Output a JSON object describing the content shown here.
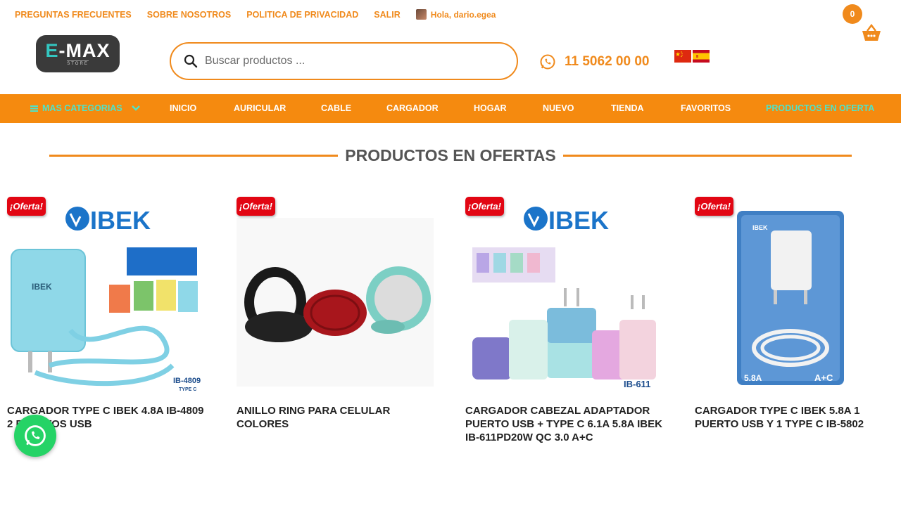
{
  "topbar": {
    "links": [
      "PREGUNTAS FRECUENTES",
      "SOBRE NOSOTROS",
      "POLITICA DE PRIVACIDAD",
      "SALIR"
    ],
    "greeting": "Hola, dario.egea"
  },
  "cart": {
    "count": "0",
    "icon": "basket-icon"
  },
  "logo": {
    "main_e": "E",
    "main_rest": "-MAX",
    "sub": "STORE"
  },
  "search": {
    "placeholder": "Buscar productos ...",
    "value": ""
  },
  "phone": {
    "number": "11 5062 00 00",
    "icon": "whatsapp-icon"
  },
  "flags": [
    "china-flag",
    "spain-flag"
  ],
  "nav": {
    "categories_label": "MAS CATEGORIAS",
    "items": [
      "INICIO",
      "AURICULAR",
      "CABLE",
      "CARGADOR",
      "HOGAR",
      "NUEVO",
      "TIENDA",
      "FAVORITOS",
      "PRODUCTOS EN OFERTA"
    ]
  },
  "section": {
    "title": "PRODUCTOS EN OFERTAS"
  },
  "products": [
    {
      "badge": "¡Oferta!",
      "name": "CARGADOR TYPE C IBEK 4.8A IB-4809 2 PUERTOS USB",
      "img_brand": "IBEK",
      "img_model": "IB-4809",
      "img_sub": "TYPE C"
    },
    {
      "badge": "¡Oferta!",
      "name": "ANILLO RING PARA CELULAR COLORES"
    },
    {
      "badge": "¡Oferta!",
      "name": "CARGADOR CABEZAL ADAPTADOR PUERTO USB + TYPE C 6.1A 5.8A IBEK IB-611PD20W QC 3.0 A+C",
      "img_brand": "IBEK",
      "img_model": "IB-611"
    },
    {
      "badge": "¡Oferta!",
      "name": "CARGADOR TYPE C IBEK 5.8A 1 PUERTO USB Y 1 TYPE C IB-5802",
      "img_brand": "IBEK",
      "img_model": "5.8A",
      "img_sub": "A+C"
    }
  ],
  "colors": {
    "accent": "#f08a1c",
    "nav_bg": "#f58a0f",
    "nav_highlight": "#4fe3c9",
    "badge": "#e20613",
    "whatsapp": "#25d366"
  }
}
